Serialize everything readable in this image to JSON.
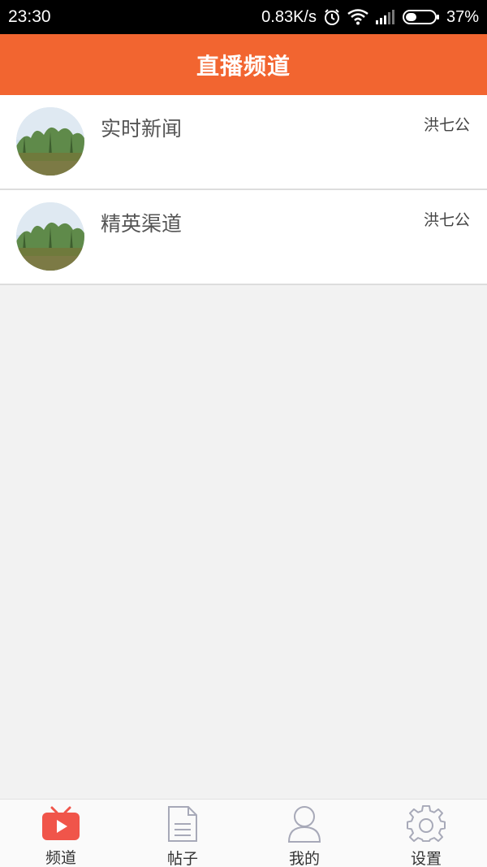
{
  "status_bar": {
    "time": "23:30",
    "network_speed": "0.83K/s",
    "battery_percent": "37%",
    "battery_level": 0.37,
    "icons": [
      "alarm-icon",
      "wifi-icon",
      "signal-icon",
      "battery-icon"
    ]
  },
  "header": {
    "title": "直播频道"
  },
  "channels": [
    {
      "name": "实时新闻",
      "author": "洪七公",
      "avatar": "landscape-thumbnail"
    },
    {
      "name": "精英渠道",
      "author": "洪七公",
      "avatar": "landscape-thumbnail"
    }
  ],
  "bottom_nav": {
    "items": [
      {
        "label": "频道",
        "icon": "tv-play-icon",
        "active": true
      },
      {
        "label": "帖子",
        "icon": "document-icon",
        "active": false
      },
      {
        "label": "我的",
        "icon": "user-icon",
        "active": false
      },
      {
        "label": "设置",
        "icon": "gear-icon",
        "active": false
      }
    ]
  },
  "colors": {
    "accent": "#f26530",
    "status_bar": "#000000",
    "background": "#f2f2f2",
    "active_icon": "#f0554a",
    "inactive_icon": "#a7a9b8"
  }
}
